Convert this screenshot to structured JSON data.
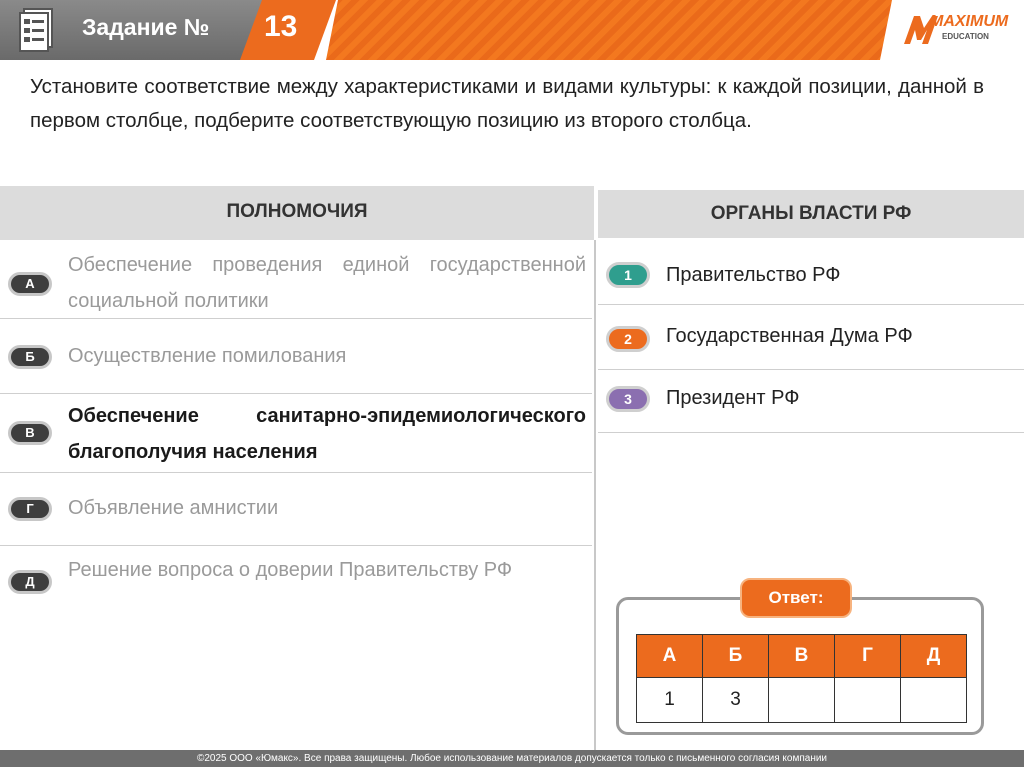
{
  "header": {
    "title": "Задание №",
    "number": "13",
    "logo_text": "MAXIMUM",
    "logo_sub": "EDUCATION",
    "icon": "document-icon"
  },
  "question": "Установите соответствие между характеристиками и видами культуры: к каждой позиции, данной в первом столбце, подберите соответствующую позицию из второго столбца.",
  "left_header": "ПОЛНОМОЧИЯ",
  "right_header": "ОРГАНЫ ВЛАСТИ РФ",
  "left_items": [
    {
      "letter": "А",
      "text": "Обеспечение проведения единой государственной социальной политики"
    },
    {
      "letter": "Б",
      "text": "Осуществление помилования"
    },
    {
      "letter": "В",
      "text": "Обеспечение санитарно-эпидемиологического благополучия населения"
    },
    {
      "letter": "Г",
      "text": "Объявление амнистии"
    },
    {
      "letter": "Д",
      "text": "Решение вопроса о доверии Правительству РФ"
    }
  ],
  "right_items": [
    {
      "num": "1",
      "text": "Правительство РФ",
      "color": "#2f9e8e"
    },
    {
      "num": "2",
      "text": "Государственная Дума РФ",
      "color": "#ec6b1e"
    },
    {
      "num": "3",
      "text": "Президент РФ",
      "color": "#8b6fb0"
    }
  ],
  "answer": {
    "label": "Ответ:",
    "letters": [
      "А",
      "Б",
      "В",
      "Г",
      "Д"
    ],
    "values": [
      "1",
      "3",
      "",
      "",
      ""
    ]
  },
  "footer": "©2025 ООО «Юмакс». Все права защищены. Любое использование материалов допускается только с  письменного согласия компании"
}
